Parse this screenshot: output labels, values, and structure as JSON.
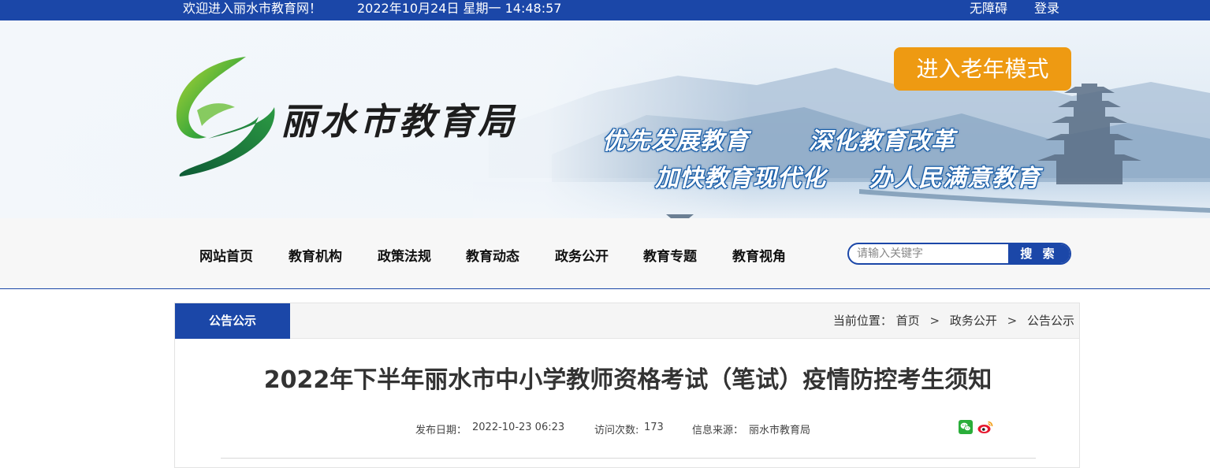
{
  "topbar": {
    "welcome": "欢迎进入丽水市教育网！",
    "datetime": "2022年10月24日 星期一 14:48:57",
    "accessible": "无障碍",
    "login": "登录"
  },
  "banner": {
    "logo_text": "丽水市教育局",
    "elder_mode": "进入老年模式",
    "slogans": [
      "优先发展教育",
      "深化教育改革",
      "加快教育现代化",
      "办人民满意教育"
    ]
  },
  "nav": {
    "items": [
      "网站首页",
      "教育机构",
      "政策法规",
      "教育动态",
      "政务公开",
      "教育专题",
      "教育视角"
    ],
    "search_placeholder": "请输入关键字",
    "search_button": "搜 索"
  },
  "section": {
    "tab": "公告公示",
    "breadcrumb_label": "当前位置：",
    "breadcrumb": [
      "首页",
      "政务公开",
      "公告公示"
    ],
    "separator": ">"
  },
  "article": {
    "title": "2022年下半年丽水市中小学教师资格考试（笔试）疫情防控考生须知",
    "publish_label": "发布日期：",
    "publish_date": "2022-10-23 06:23",
    "visits_label": "访问次数:",
    "visits": "173",
    "source_label": "信息来源：",
    "source": "丽水市教育局"
  },
  "icons": {
    "wechat": "wechat-share-icon",
    "weibo": "weibo-share-icon"
  },
  "colors": {
    "brand_blue": "#1b47a8",
    "elder_orange": "#ee9a12"
  }
}
